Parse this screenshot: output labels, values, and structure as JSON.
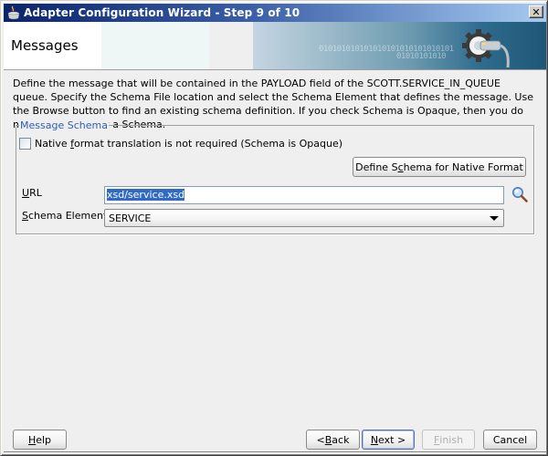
{
  "window": {
    "title": "Adapter Configuration Wizard - Step 9 of 10",
    "close_label": "✕"
  },
  "banner": {
    "title": "Messages",
    "binary_line1": "010101010101010101010101010101",
    "binary_line2": "01010101010"
  },
  "description": "Define the message that will be contained in the PAYLOAD field of the SCOTT.SERVICE_IN_QUEUE queue.  Specify the Schema File location and select the Schema Element that defines the message. Use the Browse button to find an existing schema definition. If you check Schema is Opaque, then you do not need to specify a Schema.",
  "message_schema": {
    "legend": "Message Schema",
    "opaque_checkbox": {
      "label_pre": "Native ",
      "label_mnemonic": "f",
      "label_post": "ormat translation is not required (Schema is Opaque)",
      "checked": false
    },
    "define_button": {
      "label_pre": "Define S",
      "label_mnemonic": "c",
      "label_post": "hema for Native Format"
    },
    "url": {
      "label_mnemonic": "U",
      "label_post": "RL",
      "value": "xsd/service.xsd"
    },
    "schema_element": {
      "label_mnemonic": "S",
      "label_post": "chema Element",
      "selected": "SERVICE"
    }
  },
  "footer": {
    "help": {
      "mnemonic": "H",
      "post": "elp"
    },
    "back": {
      "pre": "< ",
      "mnemonic": "B",
      "post": "ack"
    },
    "next": {
      "mnemonic": "N",
      "post": "ext >"
    },
    "finish": {
      "mnemonic": "F",
      "post": "inish",
      "enabled": false
    },
    "cancel": {
      "label": "Cancel"
    }
  }
}
